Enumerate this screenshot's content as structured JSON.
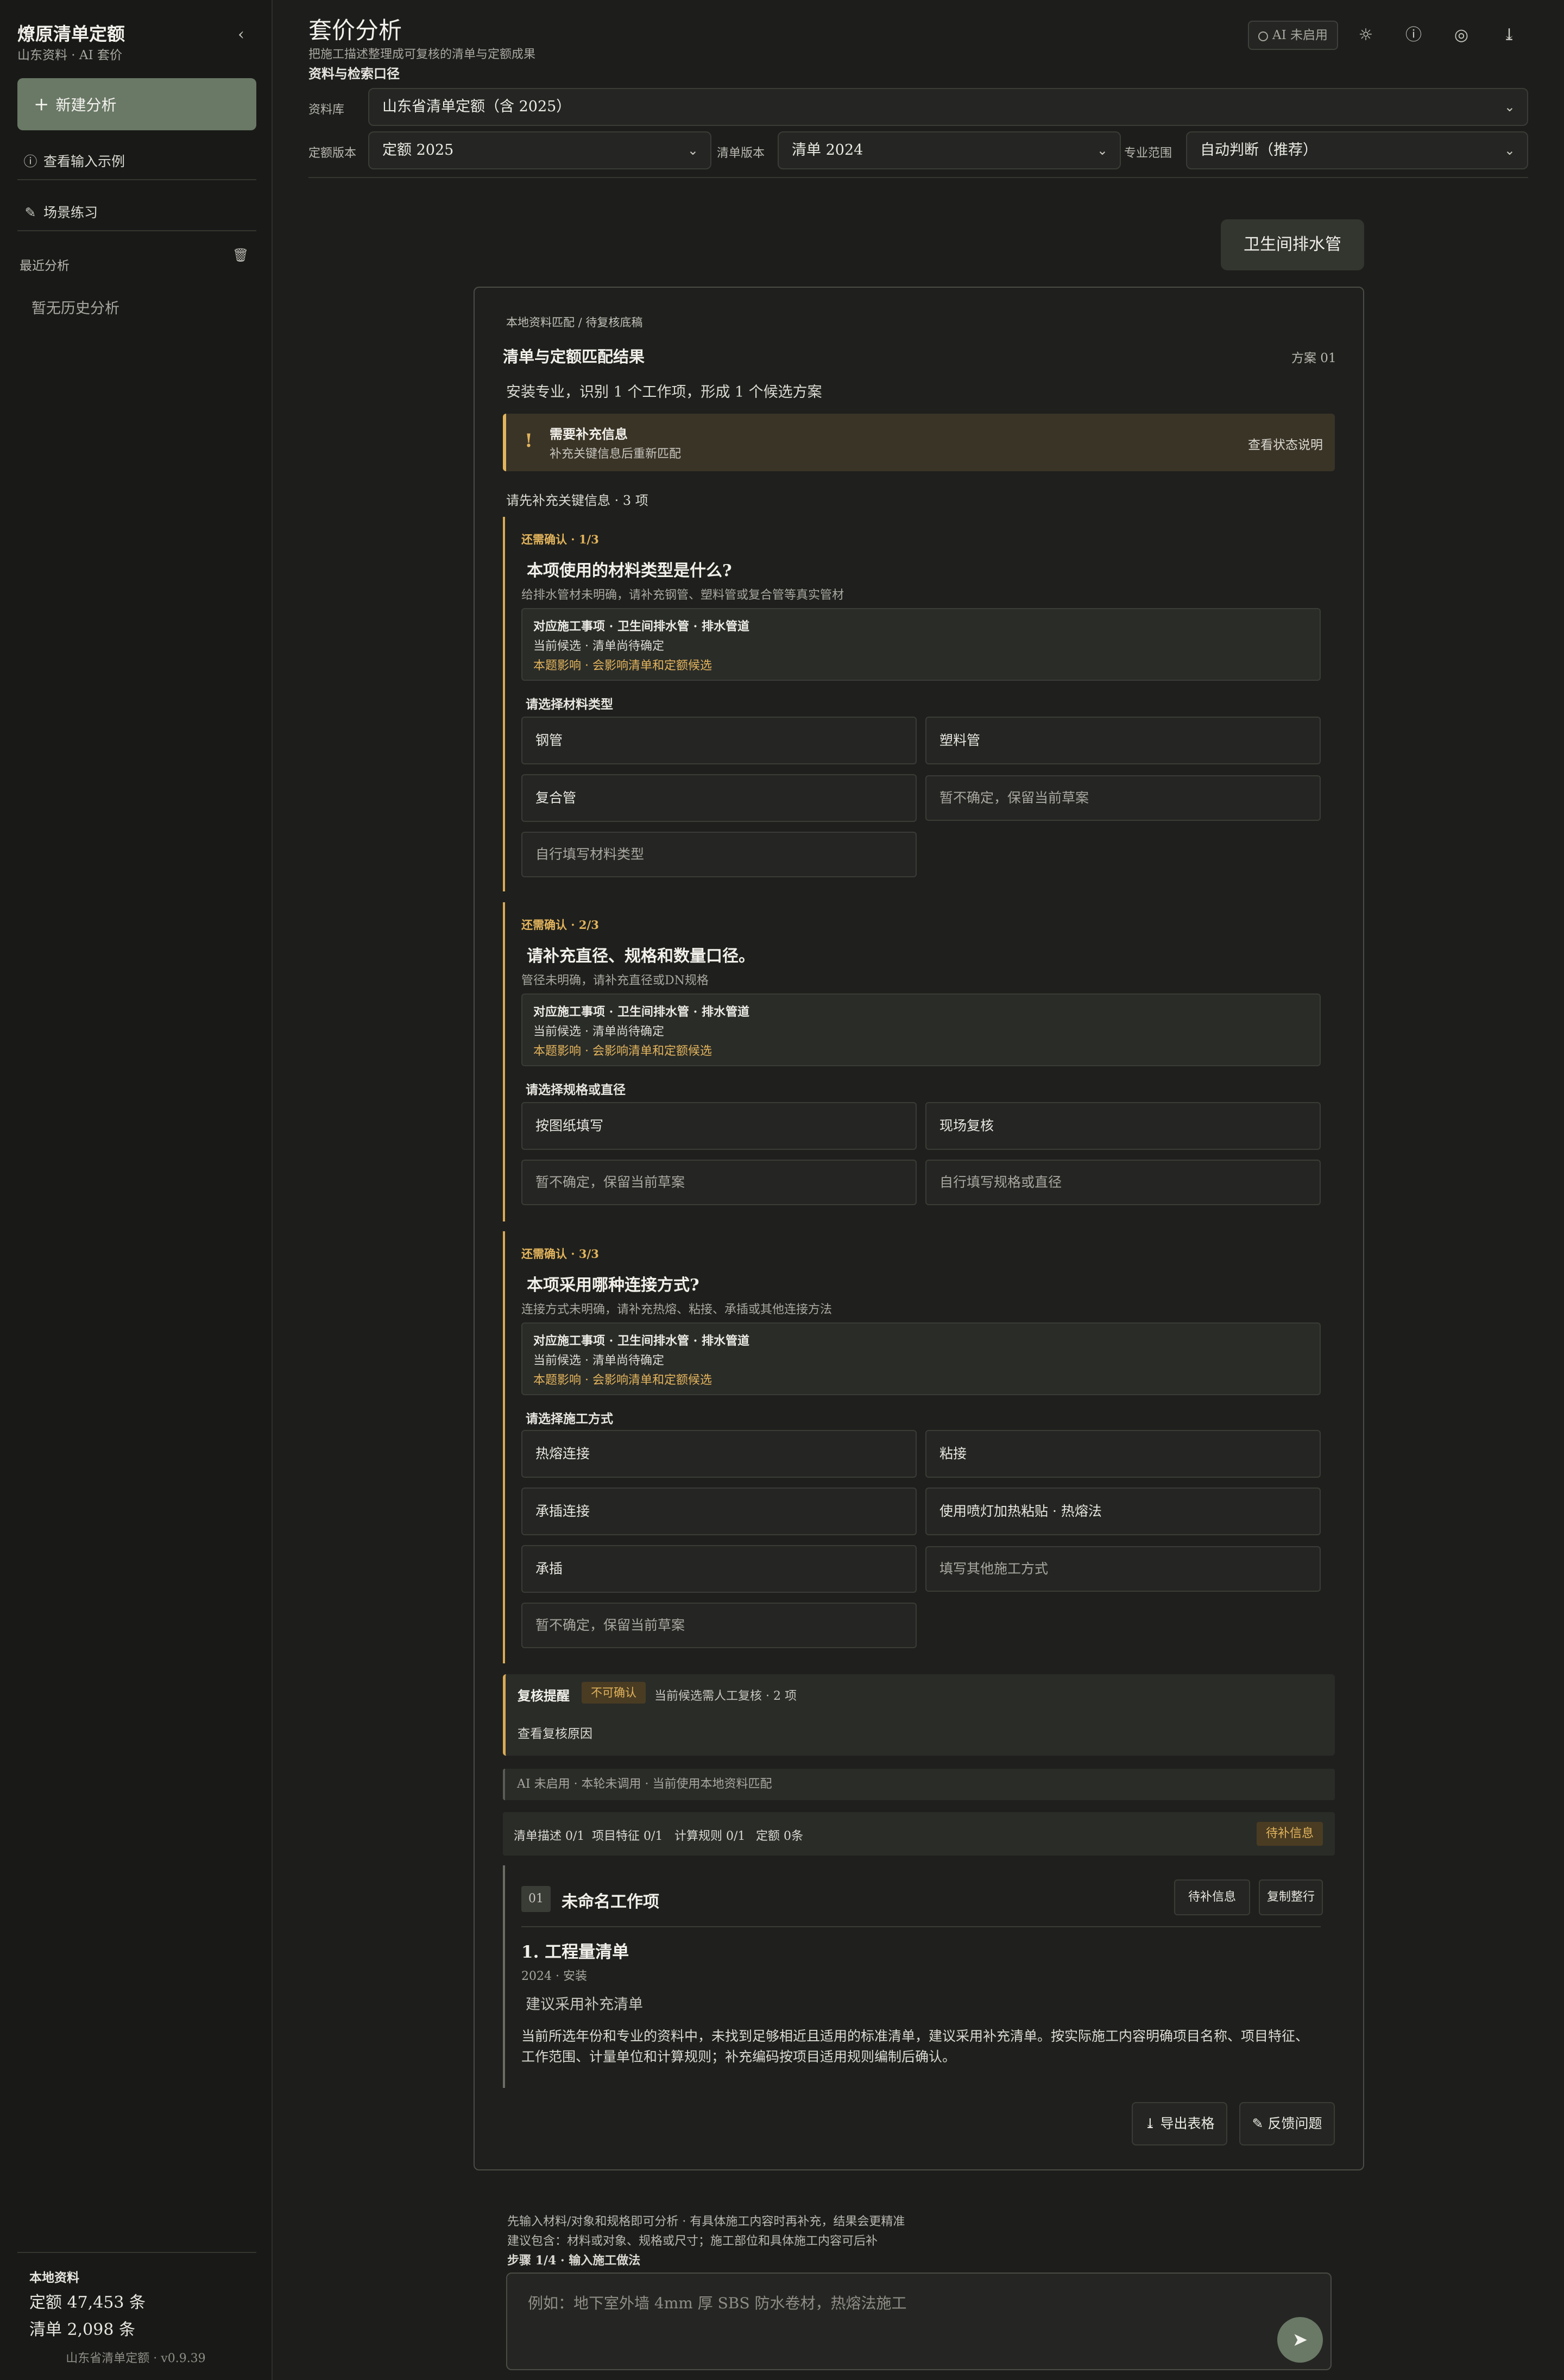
{
  "sidebar": {
    "title": "燎原清单定额",
    "subtitle": "山东资料 · AI 套价",
    "new_analysis": "新建分析",
    "view_example": "查看输入示例",
    "scene_practice": "场景练习",
    "recent_label": "最近分析",
    "empty_history": "暂无历史分析",
    "local_title": "本地资料",
    "quota_count": "定额 47,453 条",
    "list_count": "清单 2,098 条",
    "version": "山东省清单定额 · v0.9.39"
  },
  "header": {
    "title": "套价分析",
    "subtitle": "把施工描述整理成可复核的清单与定额成果",
    "ai_status": "AI 未启用",
    "section_label": "资料与检索口径"
  },
  "filters": {
    "library_label": "资料库",
    "library_value": "山东省清单定额（含 2025）",
    "quota_label": "定额版本",
    "quota_value": "定额 2025",
    "list_label": "清单版本",
    "list_value": "清单 2024",
    "scope_label": "专业范围",
    "scope_value": "自动判断（推荐）"
  },
  "chat": {
    "user_message": "卫生间排水管"
  },
  "result": {
    "breadcrumb": "本地资料匹配 / 待复核底稿",
    "title": "清单与定额匹配结果",
    "plan": "方案 01",
    "summary": "安装专业，识别 1 个工作项，形成 1 个候选方案",
    "warning_title": "需要补充信息",
    "warning_sub": "补充关键信息后重新匹配",
    "warning_link": "查看状态说明",
    "need_info": "请先补充关键信息 · 3 项",
    "questions": [
      {
        "tag": "还需确认 · 1/3",
        "title": "本项使用的材料类型是什么?",
        "desc": "给排水管材未明确，请补充钢管、塑料管或复合管等真实管材",
        "info1": "对应施工事项 · 卫生间排水管 · 排水管道",
        "info2": "当前候选 · 清单尚待确定",
        "info3": "本题影响 · 会影响清单和定额候选",
        "choose": "请选择材料类型",
        "options": [
          "钢管",
          "塑料管",
          "复合管",
          "暂不确定，保留当前草案",
          "自行填写材料类型"
        ]
      },
      {
        "tag": "还需确认 · 2/3",
        "title": "请补充直径、规格和数量口径。",
        "desc": "管径未明确，请补充直径或DN规格",
        "info1": "对应施工事项 · 卫生间排水管 · 排水管道",
        "info2": "当前候选 · 清单尚待确定",
        "info3": "本题影响 · 会影响清单和定额候选",
        "choose": "请选择规格或直径",
        "options": [
          "按图纸填写",
          "现场复核",
          "暂不确定，保留当前草案",
          "自行填写规格或直径"
        ]
      },
      {
        "tag": "还需确认 · 3/3",
        "title": "本项采用哪种连接方式?",
        "desc": "连接方式未明确，请补充热熔、粘接、承插或其他连接方法",
        "info1": "对应施工事项 · 卫生间排水管 · 排水管道",
        "info2": "当前候选 · 清单尚待确定",
        "info3": "本题影响 · 会影响清单和定额候选",
        "choose": "请选择施工方式",
        "options": [
          "热熔连接",
          "粘接",
          "承插连接",
          "使用喷灯加热粘贴 · 热熔法",
          "承插",
          "填写其他施工方式",
          "暂不确定，保留当前草案"
        ]
      }
    ],
    "review_title": "复核提醒",
    "review_badge": "不可确认",
    "review_note": "当前候选需人工复核 · 2 项",
    "review_link": "查看复核原因",
    "ai_note": "AI 未启用 · 本轮未调用 · 当前使用本地资料匹配",
    "stats": {
      "desc": "清单描述 0/1",
      "feature": "项目特征 0/1",
      "rule": "计算规则 0/1",
      "quota": "定额 0条",
      "badge": "待补信息"
    },
    "item": {
      "no": "01",
      "name": "未命名工作项",
      "badge_btn": "待补信息",
      "copy_btn": "复制整行",
      "section": "1. 工程量清单",
      "meta": "2024 · 安装",
      "suggest": "建议采用补充清单",
      "text": "当前所选年份和专业的资料中，未找到足够相近且适用的标准清单，建议采用补充清单。按实际施工内容明确项目名称、项目特征、工作范围、计量单位和计算规则；补充编码按项目适用规则编制后确认。"
    },
    "export_btn": "导出表格",
    "feedback_btn": "反馈问题"
  },
  "composer": {
    "hint1": "先输入材料/对象和规格即可分析 · 有具体施工内容时再补充，结果会更精准",
    "hint2": "建议包含：材料或对象、规格或尺寸；施工部位和具体施工内容可后补",
    "step": "步骤 1/4 · 输入施工做法",
    "placeholder": "例如：地下室外墙 4mm 厚 SBS 防水卷材，热熔法施工"
  }
}
